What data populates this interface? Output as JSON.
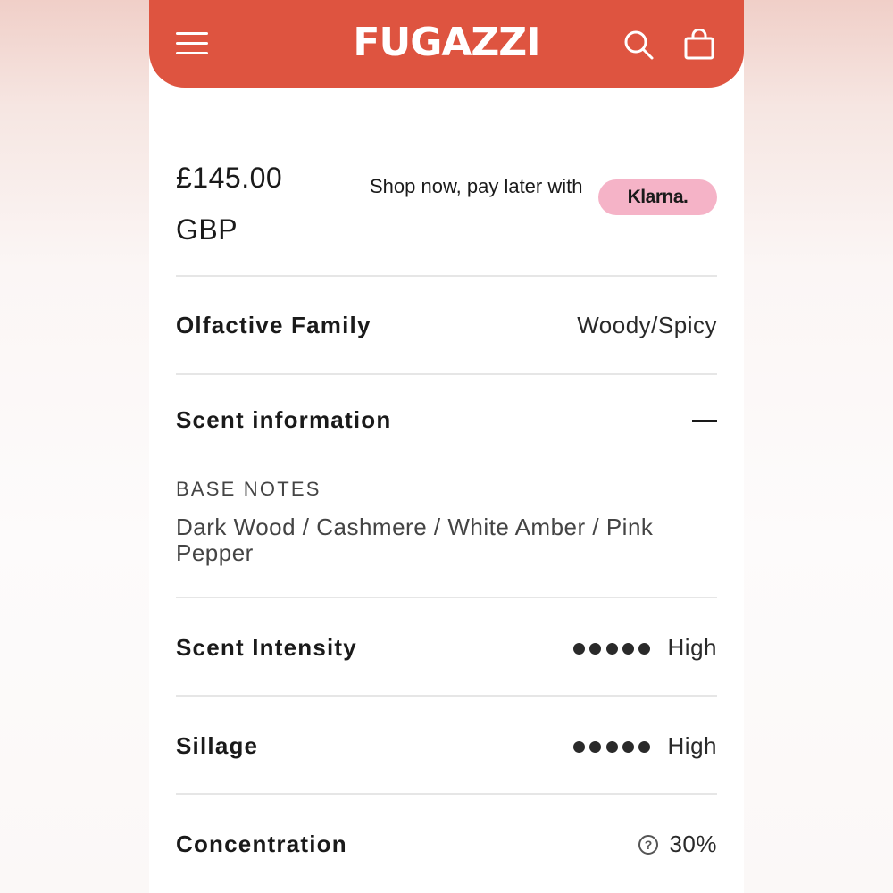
{
  "header": {
    "brand": "FUGAZZI",
    "background_color": "#de5440",
    "menu_icon": "hamburger-menu-icon",
    "search_icon": "search-icon",
    "cart_icon": "shopping-bag-icon"
  },
  "pricing": {
    "price": "£145.00",
    "currency": "GBP",
    "klarna_message": "Shop now, pay later with",
    "klarna_label": "Klarna.",
    "klarna_color": "#f5b3c7"
  },
  "details": {
    "olfactive_family": {
      "label": "Olfactive Family",
      "value": "Woody/Spicy"
    },
    "scent_information": {
      "label": "Scent information",
      "expanded": true,
      "base_notes_heading": "BASE NOTES",
      "base_notes": "Dark Wood / Cashmere / White Amber / Pink Pepper"
    },
    "scent_intensity": {
      "label": "Scent Intensity",
      "level": 5,
      "max": 5,
      "value": "High"
    },
    "sillage": {
      "label": "Sillage",
      "level": 5,
      "max": 5,
      "value": "High"
    },
    "concentration": {
      "label": "Concentration",
      "value": "30%",
      "icon": "question-circle-icon"
    }
  }
}
